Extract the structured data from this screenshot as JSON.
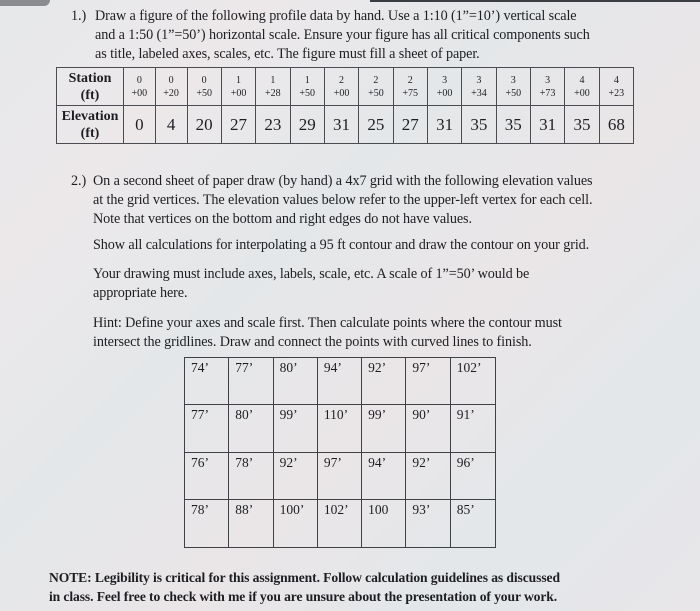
{
  "q1": {
    "number": "1.)",
    "lines": [
      "Draw a figure of the following profile data by hand. Use a 1:10 (1”=10’) vertical scale",
      "and a 1:50 (1”=50’) horizontal scale. Ensure your figure has all critical components such",
      "as title, labeled axes, scales, etc. The figure must fill a sheet of paper."
    ]
  },
  "profile_table": {
    "station_header": [
      "Station",
      "(ft)"
    ],
    "elevation_header": [
      "Elevation",
      "(ft)"
    ],
    "stations": [
      [
        "0",
        "+00"
      ],
      [
        "0",
        "+20"
      ],
      [
        "0",
        "+50"
      ],
      [
        "1",
        "+00"
      ],
      [
        "1",
        "+28"
      ],
      [
        "1",
        "+50"
      ],
      [
        "2",
        "+00"
      ],
      [
        "2",
        "+50"
      ],
      [
        "2",
        "+75"
      ],
      [
        "3",
        "+00"
      ],
      [
        "3",
        "+34"
      ],
      [
        "3",
        "+50"
      ],
      [
        "3",
        "+73"
      ],
      [
        "4",
        "+00"
      ],
      [
        "4",
        "+23"
      ]
    ],
    "elevations": [
      "0",
      "4",
      "20",
      "27",
      "23",
      "29",
      "31",
      "25",
      "27",
      "31",
      "35",
      "35",
      "31",
      "35",
      "68"
    ]
  },
  "q2": {
    "number": "2.)",
    "lines": [
      "On a second sheet of paper draw (by hand) a 4x7 grid with the following elevation values",
      "at the grid vertices. The elevation values below refer to the upper-left vertex for each cell.",
      "Note that vertices on the bottom and right edges do not have values."
    ],
    "calc": "Show all calculations for interpolating a 95 ft contour and draw the contour on your grid.",
    "drawing": [
      "Your drawing must include axes, labels, scale, etc. A scale of 1”=50’ would be",
      "appropriate here."
    ],
    "hint": [
      "Hint: Define your axes and scale first. Then calculate points where the contour must",
      "intersect the gridlines. Draw and connect the points with curved lines to finish."
    ]
  },
  "elevation_grid": [
    [
      "74’",
      "77’",
      "80’",
      "94’",
      "92’",
      "97’",
      "102’"
    ],
    [
      "77’",
      "80’",
      "99’",
      "110’",
      "99’",
      "90’",
      "91’"
    ],
    [
      "76’",
      "78’",
      "92’",
      "97’",
      "94’",
      "92’",
      "96’"
    ],
    [
      "78’",
      "88’",
      "100’",
      "102’",
      "100",
      "93’",
      "85’"
    ]
  ],
  "note": [
    "NOTE: Legibility is critical for this assignment. Follow calculation guidelines as discussed",
    "in class. Feel free to check with me if you are unsure about the presentation of your work."
  ]
}
